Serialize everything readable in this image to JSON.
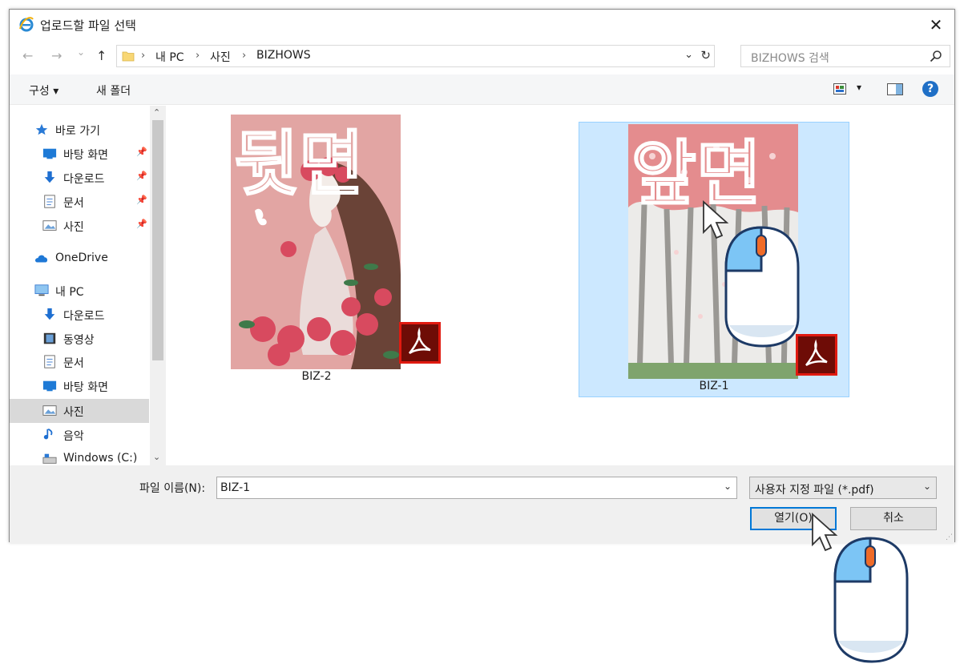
{
  "window": {
    "title": "업로드할 파일 선택",
    "close_symbol": "✕"
  },
  "nav": {
    "back_symbol": "←",
    "forward_symbol": "→",
    "recent_symbol": "⌄",
    "up_symbol": "↑",
    "crumbs": [
      "내 PC",
      "사진",
      "BIZHOWS"
    ],
    "search_placeholder": "BIZHOWS 검색"
  },
  "toolbar": {
    "organize_label": "구성 ▾",
    "new_folder_label": "새 폴더",
    "help_label": "?"
  },
  "sidebar": {
    "items": [
      {
        "label": "바로 가기",
        "icon": "star-icon",
        "pinned": false
      },
      {
        "label": "바탕 화면",
        "icon": "desktop-icon",
        "pinned": true
      },
      {
        "label": "다운로드",
        "icon": "download-icon",
        "pinned": true
      },
      {
        "label": "문서",
        "icon": "document-icon",
        "pinned": true
      },
      {
        "label": "사진",
        "icon": "pictures-icon",
        "pinned": true
      },
      {
        "label": "OneDrive",
        "icon": "cloud-icon",
        "pinned": false
      },
      {
        "label": "내 PC",
        "icon": "pc-icon",
        "pinned": false
      },
      {
        "label": "다운로드",
        "icon": "download-icon",
        "pinned": false
      },
      {
        "label": "동영상",
        "icon": "video-icon",
        "pinned": false
      },
      {
        "label": "문서",
        "icon": "document-icon",
        "pinned": false
      },
      {
        "label": "바탕 화면",
        "icon": "desktop-icon",
        "pinned": false
      },
      {
        "label": "사진",
        "icon": "pictures-icon",
        "pinned": false
      },
      {
        "label": "음악",
        "icon": "music-icon",
        "pinned": false
      },
      {
        "label": "Windows (C:)",
        "icon": "drive-icon",
        "pinned": false
      }
    ],
    "selected_index": 11
  },
  "files": [
    {
      "name": "BIZ-2",
      "cover_text": "뒷면",
      "selected": false
    },
    {
      "name": "BIZ-1",
      "cover_text": "앞면",
      "selected": true
    }
  ],
  "bottom": {
    "filename_label": "파일 이름(N):",
    "filename_value": "BIZ-1",
    "filetype_value": "사용자 지정 파일 (*.pdf)",
    "open_label": "열기(O)",
    "cancel_label": "취소"
  },
  "colors": {
    "accent": "#0078d7",
    "selection": "#cce8ff",
    "pdf_red": "#e01a10",
    "mouse_blue": "#7cc5f5",
    "mouse_outline": "#1d3a66"
  }
}
